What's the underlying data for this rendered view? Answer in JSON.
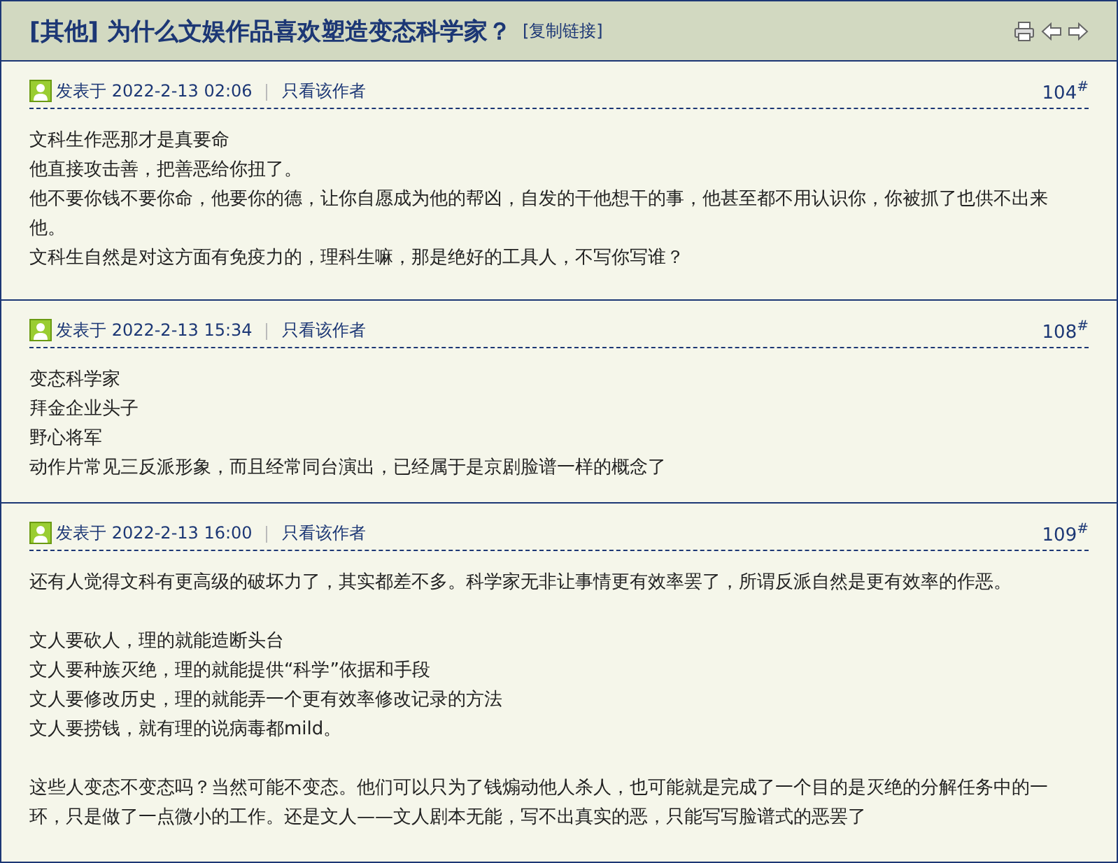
{
  "thread": {
    "category": "[其他]",
    "title": "为什么文娱作品喜欢塑造变态科学家？",
    "copy_link": "[复制链接]"
  },
  "posts": [
    {
      "posted_label": "发表于",
      "time": "2022-2-13 02:06",
      "author_only": "只看该作者",
      "floor": "104",
      "floor_mark": "#",
      "blocks": [
        [
          "文科生作恶那才是真要命",
          "他直接攻击善，把善恶给你扭了。",
          "他不要你钱不要你命，他要你的德，让你自愿成为他的帮凶，自发的干他想干的事，他甚至都不用认识你，你被抓了也供不出来他。",
          "文科生自然是对这方面有免疫力的，理科生嘛，那是绝好的工具人，不写你写谁？"
        ]
      ]
    },
    {
      "posted_label": "发表于",
      "time": "2022-2-13 15:34",
      "author_only": "只看该作者",
      "floor": "108",
      "floor_mark": "#",
      "blocks": [
        [
          "变态科学家",
          "拜金企业头子",
          "野心将军",
          "动作片常见三反派形象，而且经常同台演出，已经属于是京剧脸谱一样的概念了"
        ]
      ]
    },
    {
      "posted_label": "发表于",
      "time": "2022-2-13 16:00",
      "author_only": "只看该作者",
      "floor": "109",
      "floor_mark": "#",
      "blocks": [
        [
          "还有人觉得文科有更高级的破坏力了，其实都差不多。科学家无非让事情更有效率罢了，所谓反派自然是更有效率的作恶。"
        ],
        [
          "文人要砍人，理的就能造断头台",
          "文人要种族灭绝，理的就能提供“科学”依据和手段",
          "文人要修改历史，理的就能弄一个更有效率修改记录的方法",
          "文人要捞钱，就有理的说病毒都mild。"
        ],
        [
          "这些人变态不变态吗？当然可能不变态。他们可以只为了钱煽动他人杀人，也可能就是完成了一个目的是灭绝的分解任务中的一环，只是做了一点微小的工作。还是文人——文人剧本无能，写不出真实的恶，只能写写脸谱式的恶罢了"
        ]
      ]
    }
  ]
}
